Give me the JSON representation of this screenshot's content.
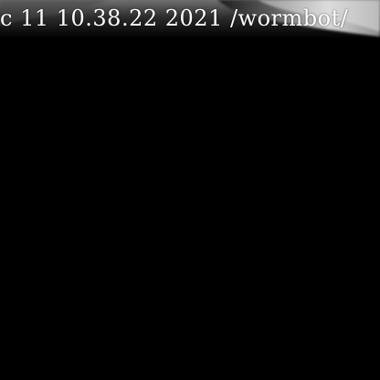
{
  "overlay": {
    "timestamp_text": "c 11 10.38.22 2021 /wormbot/"
  },
  "scene": {
    "background_color": "#000000",
    "highlight_color": "#d9d9d9"
  }
}
